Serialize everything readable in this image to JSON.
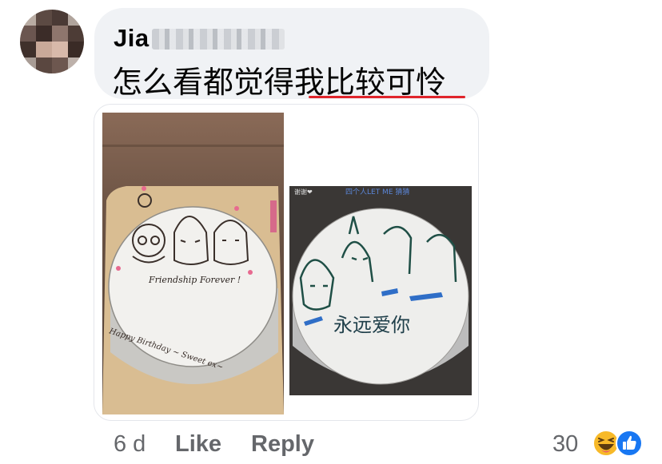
{
  "comment": {
    "author_visible": "Jia",
    "text": "怎么看都觉得我比较可怜",
    "meta": {
      "time": "6 d",
      "like_label": "Like",
      "reply_label": "Reply",
      "reaction_count": "30"
    },
    "reactions": [
      "haha-emoji-icon",
      "like-thumb-icon"
    ]
  },
  "attachment": {
    "photo1": {
      "cake_text": "Friendship Forever !",
      "rim_text": "Happy Birthday ~ Sweet ex~"
    },
    "photo2": {
      "top_label": "四个人LET ME 猜猜",
      "corner_label": "谢谢❤",
      "cake_text": "永远爱你"
    }
  },
  "colors": {
    "bubble": "#f0f2f5",
    "text": "#050505",
    "secondary": "#65676b",
    "highlight_underline": "#e0242b",
    "like_blue": "#1877f2",
    "haha_yellow": "#f7b928"
  }
}
